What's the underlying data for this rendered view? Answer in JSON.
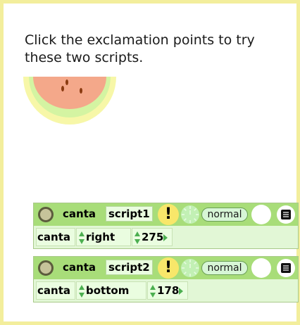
{
  "instructions": "Click the exclamation points to try these two scripts.",
  "scripts": [
    {
      "actor": "canta",
      "script_name": "script1",
      "run_glyph": "!",
      "status": "normal",
      "command": {
        "target": "canta",
        "property": "right",
        "value": "275"
      }
    },
    {
      "actor": "canta",
      "script_name": "script2",
      "run_glyph": "!",
      "status": "normal",
      "command": {
        "target": "canta",
        "property": "bottom",
        "value": "178"
      }
    }
  ],
  "icons": {
    "grip": "grip-circle-icon",
    "run": "exclamation-icon",
    "timer": "clock-icon",
    "menu": "menu-icon",
    "stepper": "up-down-arrows-icon",
    "watermelon": "watermelon-slice-icon"
  },
  "colors": {
    "frame": "#f3ee9c",
    "script_header": "#a8dd79",
    "script_body": "#e2f7d6",
    "run_button": "#f8e76a"
  }
}
